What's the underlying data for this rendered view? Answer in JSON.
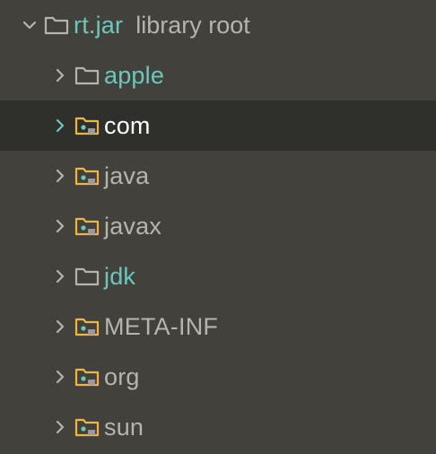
{
  "tree": {
    "root": {
      "name": "rt.jar",
      "suffix": "library root",
      "icon": "folder-outline-icon",
      "expanded": true
    },
    "items": [
      {
        "name": "apple",
        "icon": "folder-outline-icon",
        "selected": false,
        "color": "#6cc7bd"
      },
      {
        "name": "com",
        "icon": "package-folder-icon",
        "selected": true,
        "color": "#ffffff"
      },
      {
        "name": "java",
        "icon": "package-folder-icon",
        "selected": false,
        "color": "#b6b5ad"
      },
      {
        "name": "javax",
        "icon": "package-folder-icon",
        "selected": false,
        "color": "#b6b5ad"
      },
      {
        "name": "jdk",
        "icon": "folder-outline-icon",
        "selected": false,
        "color": "#6cc7bd"
      },
      {
        "name": "META-INF",
        "icon": "package-folder-icon",
        "selected": false,
        "color": "#b6b5ad"
      },
      {
        "name": "org",
        "icon": "package-folder-icon",
        "selected": false,
        "color": "#b6b5ad"
      },
      {
        "name": "sun",
        "icon": "package-folder-icon",
        "selected": false,
        "color": "#b6b5ad"
      }
    ]
  },
  "colors": {
    "background": "#42413b",
    "selection": "#2f2f2b",
    "teal": "#6cc7bd",
    "folder_yellow": "#f0b53f",
    "chevron": "#b6b5ad",
    "chevron_selected": "#6cc7bd"
  }
}
